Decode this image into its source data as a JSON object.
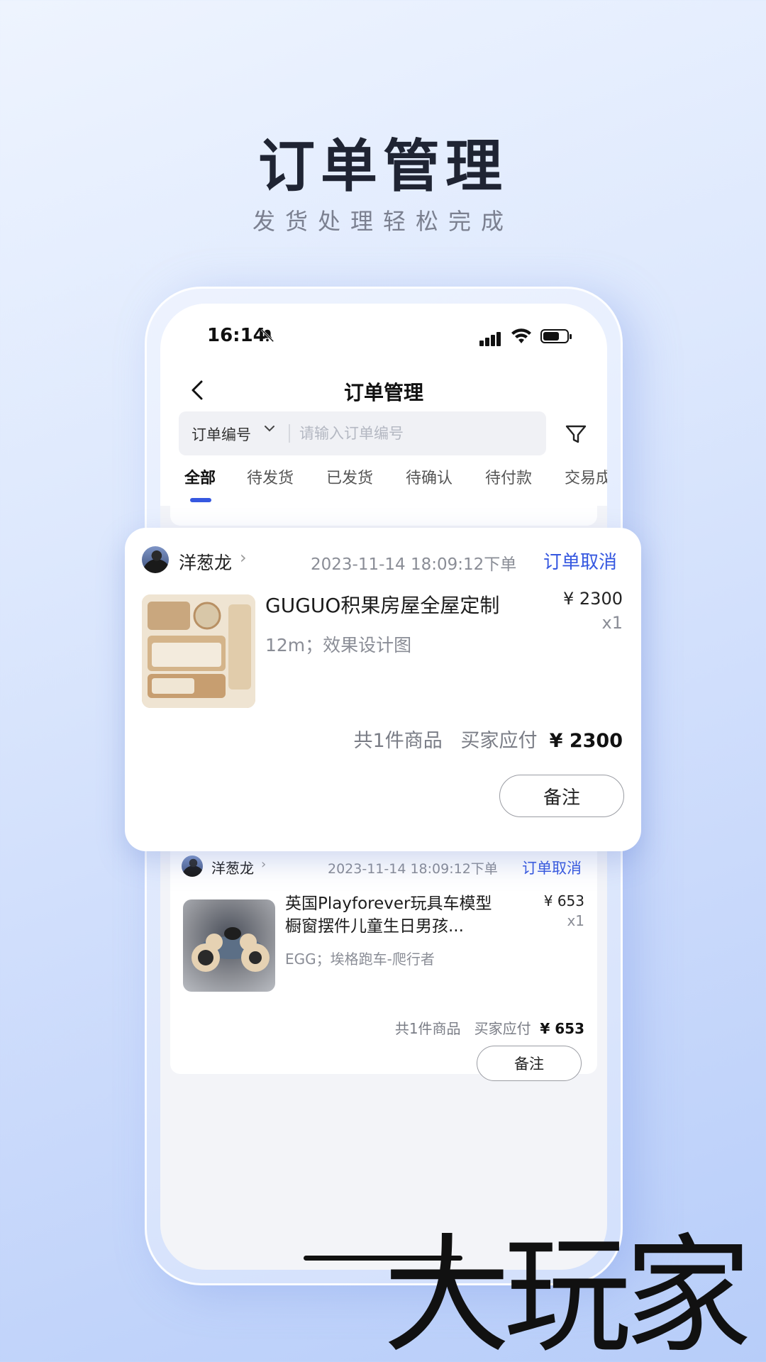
{
  "hero": {
    "title": "订单管理",
    "subtitle": "发货处理轻松完成"
  },
  "status_bar": {
    "time": "16:14"
  },
  "header": {
    "title": "订单管理"
  },
  "search": {
    "field_label": "订单编号",
    "placeholder": "请输入订单编号"
  },
  "tabs": [
    {
      "label": "全部",
      "active": true
    },
    {
      "label": "待发货"
    },
    {
      "label": "已发货"
    },
    {
      "label": "待确认"
    },
    {
      "label": "待付款"
    },
    {
      "label": "交易成"
    }
  ],
  "orders": [
    {
      "buyer": "洋葱龙",
      "datetime": "2023-11-14 18:09:12下单",
      "action": "订单取消",
      "product_name": "GUGUO积果房屋全屋定制",
      "spec": "12m；效果设计图",
      "price": "¥ 2300",
      "qty": "x1",
      "count_text": "共1件商品",
      "pay_label": "买家应付",
      "pay_amount": "¥ 2300",
      "button": "备注"
    },
    {
      "buyer": "洋葱龙",
      "datetime": "2023-11-14 18:09:12下单",
      "action": "订单取消",
      "product_name_line1": "英国Playforever玩具车模型",
      "product_name_line2": "橱窗摆件儿童生日男孩...",
      "spec": "EGG；埃格跑车-爬行者",
      "price": "¥ 653",
      "qty": "x1",
      "count_text": "共1件商品",
      "pay_label": "买家应付",
      "pay_amount": "¥ 653",
      "button": "备注"
    }
  ],
  "watermark": "大玩家",
  "colors": {
    "accent": "#3658e0",
    "text_dark": "#1f2433",
    "muted": "#8a8d96"
  }
}
